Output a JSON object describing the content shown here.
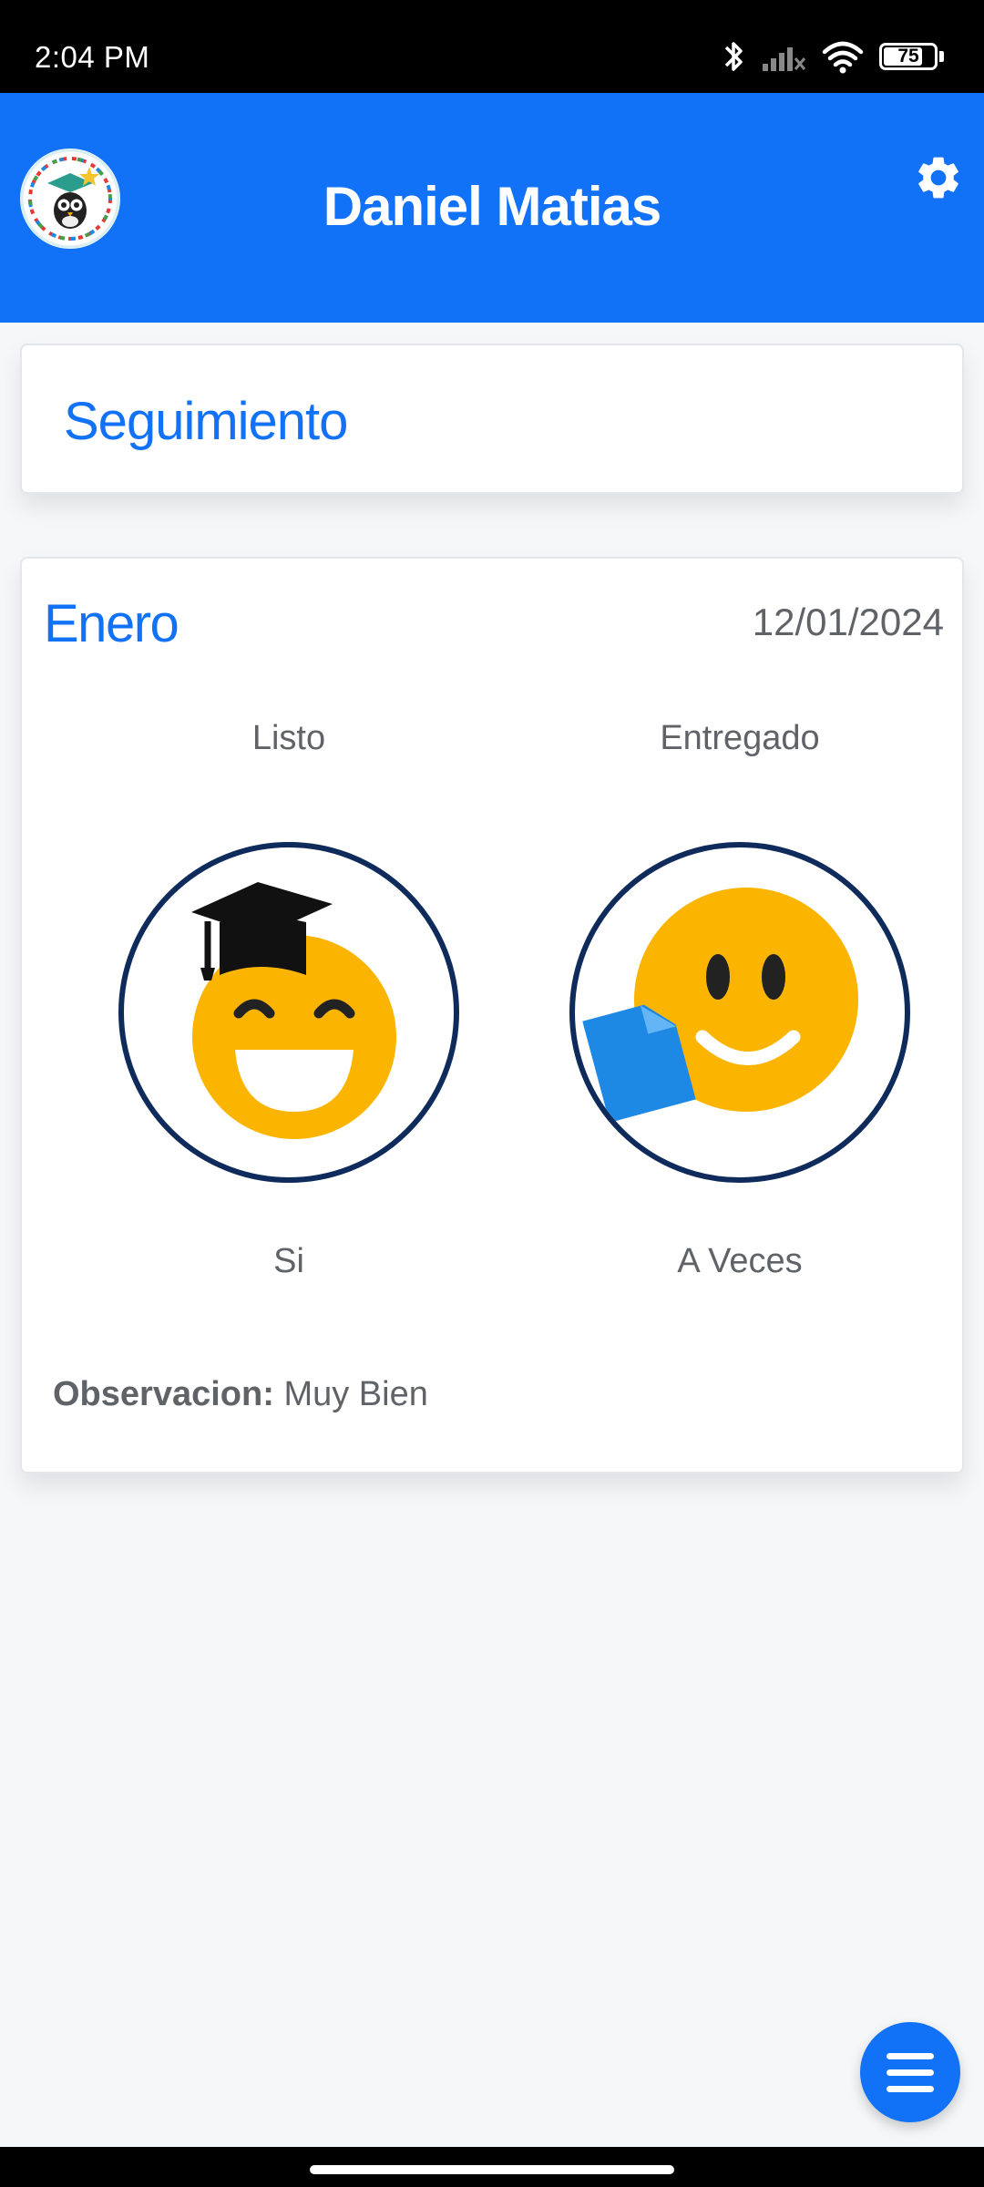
{
  "status_bar": {
    "time": "2:04 PM",
    "battery_level": "75",
    "icons": [
      "bluetooth-icon",
      "signal-icon",
      "wifi-icon",
      "battery-icon"
    ]
  },
  "header": {
    "title": "Daniel Matias",
    "background_color": "#1172f7",
    "logo_icon": "owl-graduate-logo",
    "settings_icon": "gear-icon"
  },
  "section": {
    "title": "Seguimiento"
  },
  "record": {
    "month": "Enero",
    "date": "12/01/2024",
    "items": [
      {
        "label": "Listo",
        "value": "Si",
        "icon": "graduate-smiley-icon"
      },
      {
        "label": "Entregado",
        "value": "A Veces",
        "icon": "smiley-document-icon"
      }
    ],
    "observation_label": "Observacion:",
    "observation_value": "Muy Bien"
  },
  "fab": {
    "icon": "menu-icon"
  },
  "colors": {
    "accent": "#1172f7",
    "emoji_yellow": "#fbb400",
    "circle_border": "#0e2b5c"
  }
}
